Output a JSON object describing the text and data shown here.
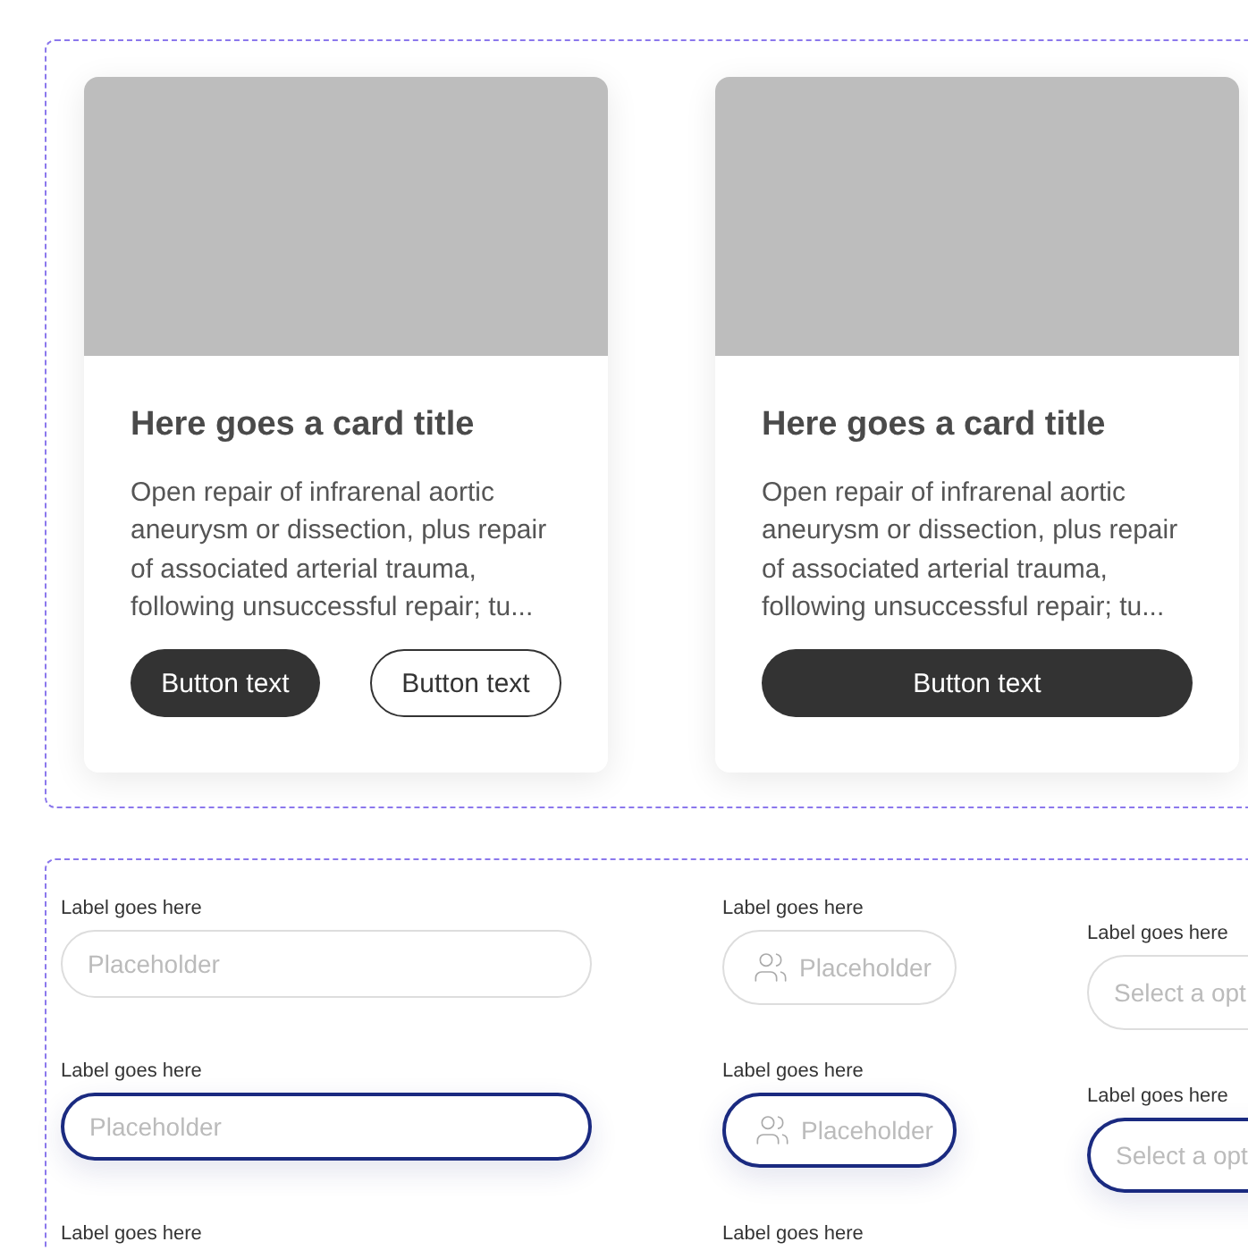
{
  "cards": [
    {
      "title": "Here goes a card title",
      "body": "Open repair of infrarenal aortic aneurysm or dissection, plus repair of associated arterial trauma, following unsuccessful repair; tu...",
      "buttons": [
        {
          "label": "Button text",
          "kind": "solid"
        },
        {
          "label": "Button text",
          "kind": "outline"
        }
      ]
    },
    {
      "title": "Here goes a card title",
      "body": "Open repair of infrarenal aortic aneurysm or dissection, plus repair of associated arterial trauma, following unsuccessful repair; tu...",
      "buttons": [
        {
          "label": "Button text",
          "kind": "wide"
        }
      ]
    }
  ],
  "form_rows": [
    {
      "fields": [
        {
          "kind": "text",
          "label": "Label goes here",
          "placeholder": "Placeholder",
          "focused": false
        },
        {
          "kind": "icon",
          "label": "Label goes here",
          "placeholder": "Placeholder",
          "focused": false
        },
        {
          "kind": "select",
          "label": "Label goes here",
          "placeholder": "Select a opt",
          "focused": false
        }
      ]
    },
    {
      "fields": [
        {
          "kind": "text",
          "label": "Label goes here",
          "placeholder": "Placeholder",
          "focused": true
        },
        {
          "kind": "icon",
          "label": "Label goes here",
          "placeholder": "Placeholder",
          "focused": true
        },
        {
          "kind": "select",
          "label": "Label goes here",
          "placeholder": "Select a opt",
          "focused": true
        }
      ]
    },
    {
      "fields": [
        {
          "kind": "text",
          "label": "Label goes here"
        },
        {
          "kind": "icon",
          "label": "Label goes here"
        }
      ]
    }
  ]
}
